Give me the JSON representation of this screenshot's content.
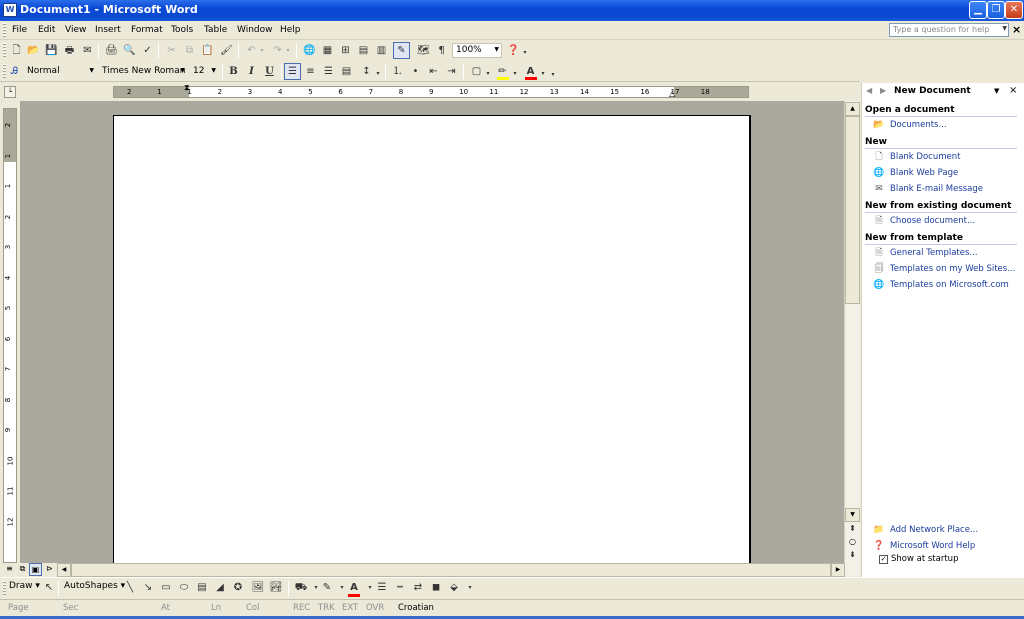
{
  "window": {
    "title": "Document1 - Microsoft Word",
    "app_icon": "W",
    "minimize": "▁",
    "restore": "❐",
    "close": "✕"
  },
  "menu": {
    "items": [
      "File",
      "Edit",
      "View",
      "Insert",
      "Format",
      "Tools",
      "Table",
      "Window",
      "Help"
    ],
    "help_placeholder": "Type a question for help",
    "close_doc": "×"
  },
  "standard_toolbar": {
    "zoom": "100%"
  },
  "formatting_toolbar": {
    "style": "Normal",
    "font": "Times New Roman",
    "size": "12",
    "bold": "B",
    "italic": "I",
    "underline": "U"
  },
  "ruler": {
    "h_numbers": [
      "2",
      "1",
      "1",
      "2",
      "3",
      "4",
      "5",
      "6",
      "7",
      "8",
      "9",
      "10",
      "11",
      "12",
      "13",
      "14",
      "15",
      "16",
      "17",
      "18"
    ],
    "v_numbers": [
      "2",
      "1",
      "1",
      "2",
      "3",
      "4",
      "5",
      "6",
      "7",
      "8",
      "9",
      "10",
      "11",
      "12"
    ]
  },
  "task_pane": {
    "title": "New Document",
    "open_section": "Open a document",
    "documents_link": "Documents...",
    "new_section": "New",
    "blank_document": "Blank Document",
    "blank_web_page": "Blank Web Page",
    "blank_email": "Blank E-mail Message",
    "existing_section": "New from existing document",
    "choose_document": "Choose document...",
    "template_section": "New from template",
    "general_templates": "General Templates...",
    "templates_web_sites": "Templates on my Web Sites...",
    "templates_microsoft": "Templates on Microsoft.com",
    "add_network_place": "Add Network Place...",
    "word_help": "Microsoft Word Help",
    "show_at_startup": "Show at startup",
    "show_at_startup_checked": true
  },
  "drawing_toolbar": {
    "draw": "Draw",
    "autoshapes": "AutoShapes"
  },
  "status_bar": {
    "page": "Page",
    "sec": "Sec",
    "at": "At",
    "ln": "Ln",
    "col": "Col",
    "rec": "REC",
    "trk": "TRK",
    "ext": "EXT",
    "ovr": "OVR",
    "language": "Croatian"
  },
  "colors": {
    "titlebar": "#0a48d6",
    "chrome": "#ece9d8",
    "link": "#1c3c9c",
    "highlight": "#ffff00",
    "font_color": "#ff0000"
  }
}
